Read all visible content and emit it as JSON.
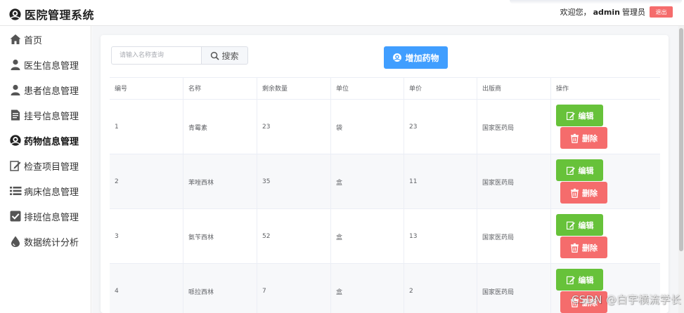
{
  "header": {
    "title": "医院管理系统",
    "welcome": "欢迎您，",
    "username": "admin",
    "role": "管理员",
    "logout_label": "退出"
  },
  "sidebar": {
    "items": [
      {
        "label": "首页",
        "icon": "home-icon"
      },
      {
        "label": "医生信息管理",
        "icon": "user-icon"
      },
      {
        "label": "患者信息管理",
        "icon": "user-icon"
      },
      {
        "label": "挂号信息管理",
        "icon": "document-icon"
      },
      {
        "label": "药物信息管理",
        "icon": "brand-icon",
        "active": true
      },
      {
        "label": "检查项目管理",
        "icon": "edit-icon"
      },
      {
        "label": "病床信息管理",
        "icon": "list-icon"
      },
      {
        "label": "排班信息管理",
        "icon": "checkbox-icon"
      },
      {
        "label": "数据统计分析",
        "icon": "drop-icon"
      }
    ]
  },
  "toolbar": {
    "search_placeholder": "请输入名称查询",
    "search_label": "搜索",
    "add_label": "增加药物"
  },
  "table": {
    "headers": [
      "编号",
      "名称",
      "剩余数量",
      "单位",
      "单价",
      "出版商",
      "操作"
    ],
    "rows": [
      {
        "id": "1",
        "name": "青霉素",
        "quantity": "23",
        "unit": "袋",
        "price": "23",
        "publisher": "国家医药局"
      },
      {
        "id": "2",
        "name": "苯唑西林",
        "quantity": "35",
        "unit": "盒",
        "price": "11",
        "publisher": "国家医药局"
      },
      {
        "id": "3",
        "name": "氨苄西林",
        "quantity": "52",
        "unit": "盒",
        "price": "13",
        "publisher": "国家医药局"
      },
      {
        "id": "4",
        "name": "哌拉西林",
        "quantity": "7",
        "unit": "盒",
        "price": "2",
        "publisher": "国家医药局"
      }
    ],
    "edit_label": "编辑",
    "delete_label": "删除"
  },
  "watermark": "CSDN @白宇横流学长",
  "colors": {
    "primary": "#409eff",
    "success": "#67c23a",
    "danger": "#f56c6c"
  }
}
